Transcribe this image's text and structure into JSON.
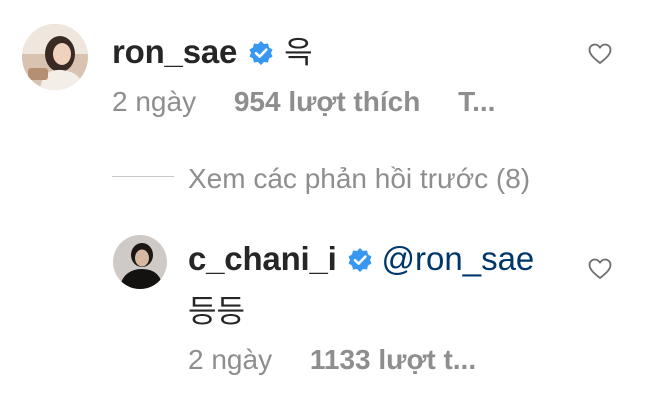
{
  "comment": {
    "username": "ron_sae",
    "text": "윽",
    "time": "2 ngày",
    "likes": "954 lượt thích",
    "reply_label": "T..."
  },
  "view_replies_label": "Xem các phản hồi trước (8)",
  "reply": {
    "username": "c_chani_i",
    "mention": "@ron_sae",
    "text": "등등",
    "time": "2 ngày",
    "likes": "1133 lượt t..."
  },
  "colors": {
    "verified": "#3897f0",
    "mention": "#00376b",
    "meta": "#8e8e8e"
  },
  "icons": {
    "heart": "heart-outline-icon",
    "verified": "verified-badge-icon"
  }
}
